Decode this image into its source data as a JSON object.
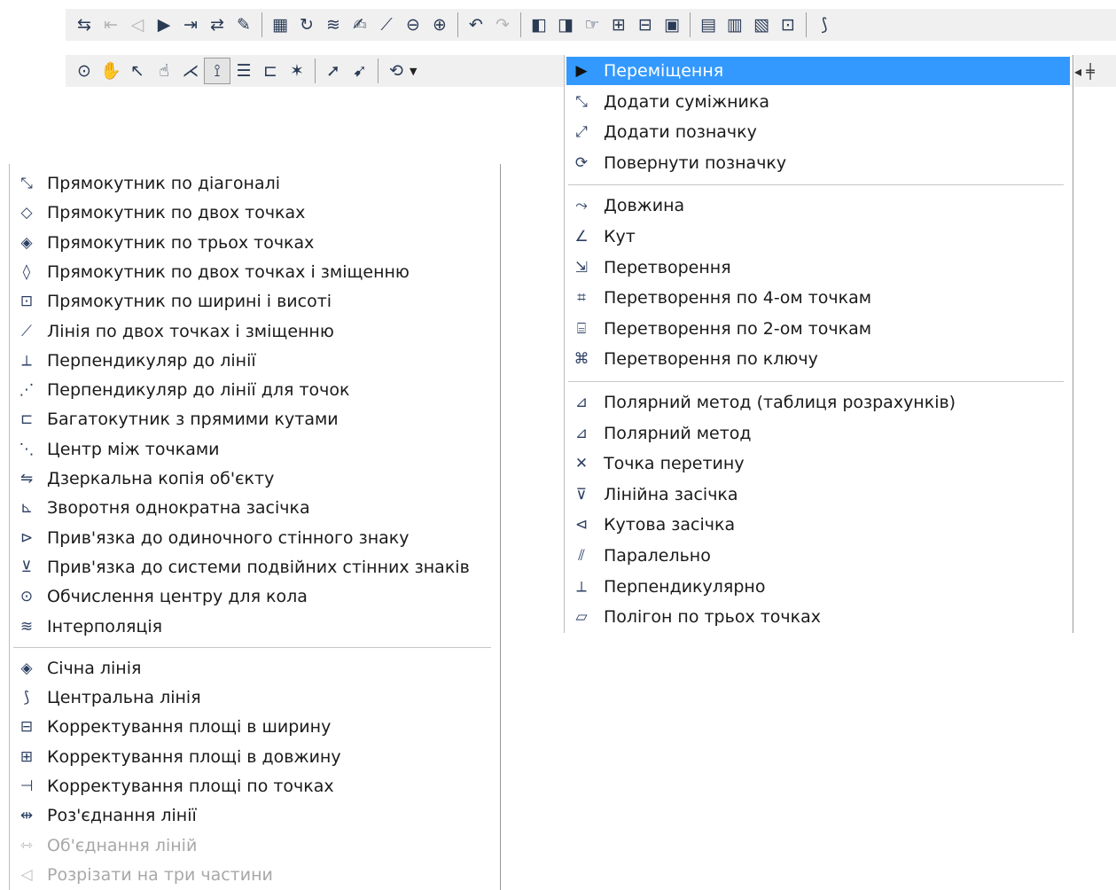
{
  "toolbar_top": [
    {
      "name": "add-row-icon",
      "glyph": "⇆"
    },
    {
      "name": "first-record-icon",
      "glyph": "⇤",
      "dim": true
    },
    {
      "name": "previous-record-icon",
      "glyph": "◁",
      "dim": true
    },
    {
      "name": "next-record-icon",
      "glyph": "▶"
    },
    {
      "name": "last-record-icon",
      "glyph": "⇥"
    },
    {
      "name": "insert-point-icon",
      "glyph": "⇄"
    },
    {
      "name": "document-stamp-icon",
      "glyph": "✎"
    },
    {
      "sep": true
    },
    {
      "name": "table-icon",
      "glyph": "▦"
    },
    {
      "name": "refresh-layer-icon",
      "glyph": "↻"
    },
    {
      "name": "layers-icon",
      "glyph": "≋"
    },
    {
      "name": "document-edit-icon",
      "glyph": "✍"
    },
    {
      "name": "polyline-icon",
      "glyph": "⟋"
    },
    {
      "name": "zoom-out-icon",
      "glyph": "⊖"
    },
    {
      "name": "zoom-in-icon",
      "glyph": "⊕"
    },
    {
      "sep": true
    },
    {
      "name": "undo-icon",
      "glyph": "↶"
    },
    {
      "name": "redo-icon",
      "glyph": "↷",
      "dim": true
    },
    {
      "sep": true
    },
    {
      "name": "frame-left-icon",
      "glyph": "◧"
    },
    {
      "name": "frame-right-icon",
      "glyph": "◨"
    },
    {
      "name": "hand-point-icon",
      "glyph": "☞"
    },
    {
      "name": "split-object-icon",
      "glyph": "⊞"
    },
    {
      "name": "merge-object-icon",
      "glyph": "⊟"
    },
    {
      "name": "photo-icon",
      "glyph": "▣"
    },
    {
      "sep": true
    },
    {
      "name": "report-icon",
      "glyph": "▤"
    },
    {
      "name": "report-list-icon",
      "glyph": "▥"
    },
    {
      "name": "print-document-icon",
      "glyph": "▧"
    },
    {
      "name": "grid-frame-icon",
      "glyph": "⊡"
    },
    {
      "sep": true
    },
    {
      "name": "more-tools-icon",
      "glyph": "⟆"
    }
  ],
  "toolbar_second": [
    {
      "name": "zoom-window-icon",
      "glyph": "⊙"
    },
    {
      "name": "pan-hand-icon",
      "glyph": "✋"
    },
    {
      "name": "select-arrow-icon",
      "glyph": "↖"
    },
    {
      "name": "select-hand-icon",
      "glyph": "☝"
    },
    {
      "name": "draw-lines-icon",
      "glyph": "⋌"
    },
    {
      "name": "snap-cursor-icon",
      "glyph": "⟟",
      "pressed": true
    },
    {
      "name": "stacked-lines-icon",
      "glyph": "☰"
    },
    {
      "name": "node-tree-icon",
      "glyph": "⊏"
    },
    {
      "name": "magic-lines-icon",
      "glyph": "✶"
    },
    {
      "sep": true
    },
    {
      "name": "green-arrow-icon",
      "glyph": "➚"
    },
    {
      "name": "red-arrow-icon",
      "glyph": "➹"
    },
    {
      "sep": true
    },
    {
      "name": "transform-tool-icon",
      "glyph": "⟲",
      "drop": true
    }
  ],
  "menu_right": {
    "items": [
      {
        "name": "move",
        "label": "Переміщення",
        "glyph": "▶",
        "selected": true
      },
      {
        "name": "add-neighbor",
        "label": "Додати суміжника",
        "glyph": "⤡"
      },
      {
        "name": "add-marker",
        "label": "Додати позначку",
        "glyph": "⤢"
      },
      {
        "name": "rotate-marker",
        "label": "Повернути позначку",
        "glyph": "⟳"
      },
      {
        "sep": true
      },
      {
        "name": "length",
        "label": "Довжина",
        "glyph": "⤳"
      },
      {
        "name": "angle",
        "label": "Кут",
        "glyph": "∠"
      },
      {
        "name": "transformation",
        "label": "Перетворення",
        "glyph": "⇲"
      },
      {
        "name": "transform-4-points",
        "label": "Перетворення по 4-ом точкам",
        "glyph": "⌗"
      },
      {
        "name": "transform-2-points",
        "label": "Перетворення по 2-ом точкам",
        "glyph": "⌸"
      },
      {
        "name": "transform-by-key",
        "label": "Перетворення по ключу",
        "glyph": "⌘"
      },
      {
        "sep": true
      },
      {
        "name": "polar-method-table",
        "label": "Полярний метод (таблиця розрахунків)",
        "glyph": "⊿"
      },
      {
        "name": "polar-method",
        "label": "Полярний метод",
        "glyph": "⊿"
      },
      {
        "name": "intersection-point",
        "label": "Точка перетину",
        "glyph": "✕"
      },
      {
        "name": "linear-resection",
        "label": "Лінійна засічка",
        "glyph": "⊽"
      },
      {
        "name": "angular-resection",
        "label": "Кутова засічка",
        "glyph": "⊲"
      },
      {
        "name": "parallel",
        "label": "Паралельно",
        "glyph": "⫽"
      },
      {
        "name": "perpendicular",
        "label": "Перпендикулярно",
        "glyph": "⟂"
      },
      {
        "name": "polygon-3-points",
        "label": "Полігон по трьох точках",
        "glyph": "▱"
      }
    ]
  },
  "menu_left": {
    "items": [
      {
        "name": "rect-diagonal",
        "label": "Прямокутник по діагоналі",
        "glyph": "⤡"
      },
      {
        "name": "rect-two-points",
        "label": "Прямокутник по двох точках",
        "glyph": "◇"
      },
      {
        "name": "rect-three-points",
        "label": "Прямокутник по трьох точках",
        "glyph": "◈"
      },
      {
        "name": "rect-two-points-offset",
        "label": "Прямокутник по двох точках і зміщенню",
        "glyph": "◊"
      },
      {
        "name": "rect-width-height",
        "label": "Прямокутник по ширині і висоті",
        "glyph": "⊡"
      },
      {
        "name": "line-two-points-offset",
        "label": "Лінія по двох точках і зміщенню",
        "glyph": "⟋"
      },
      {
        "name": "perpendicular-to-line",
        "label": "Перпендикуляр до лінії",
        "glyph": "⟂"
      },
      {
        "name": "perpendicular-to-line-points",
        "label": "Перпендикуляр до лінії для точок",
        "glyph": "⋰"
      },
      {
        "name": "right-angle-polygon",
        "label": "Багатокутник з прямими кутами",
        "glyph": "⊏"
      },
      {
        "name": "center-between-points",
        "label": "Центр між точками",
        "glyph": "⋱"
      },
      {
        "name": "mirror-copy",
        "label": "Дзеркальна копія об'єкту",
        "glyph": "⇋"
      },
      {
        "name": "inverse-resection",
        "label": "Зворотня однократна засічка",
        "glyph": "⊾"
      },
      {
        "name": "bind-wall-sign",
        "label": "Прив'язка до одиночного стінного знаку",
        "glyph": "⊳"
      },
      {
        "name": "bind-double-wall-signs",
        "label": "Прив'язка до системи подвійних стінних знаків",
        "glyph": "⊻"
      },
      {
        "name": "circle-center",
        "label": "Обчислення центру для кола",
        "glyph": "⊙"
      },
      {
        "name": "interpolation",
        "label": "Інтерполяція",
        "glyph": "≋"
      },
      {
        "sep": true
      },
      {
        "name": "secant-line",
        "label": "Січна лінія",
        "glyph": "◈"
      },
      {
        "name": "central-line",
        "label": "Центральна лінія",
        "glyph": "⟆"
      },
      {
        "name": "area-width-correction",
        "label": "Корректування площі в ширину",
        "glyph": "⊟"
      },
      {
        "name": "area-length-correction",
        "label": "Корректування площі в довжину",
        "glyph": "⊞"
      },
      {
        "name": "area-points-correction",
        "label": "Корректування площі по точках",
        "glyph": "⊣"
      },
      {
        "name": "split-line",
        "label": "Роз'єднання лінії",
        "glyph": "⇹"
      },
      {
        "name": "merge-lines",
        "label": "Об'єднання ліній",
        "glyph": "⇿",
        "disabled": true
      },
      {
        "name": "cut-three-parts",
        "label": "Розрізати на три частини",
        "glyph": "◁",
        "disabled": true
      }
    ]
  },
  "toolbar_edge_right": {
    "glyph": "◂ ╪"
  }
}
